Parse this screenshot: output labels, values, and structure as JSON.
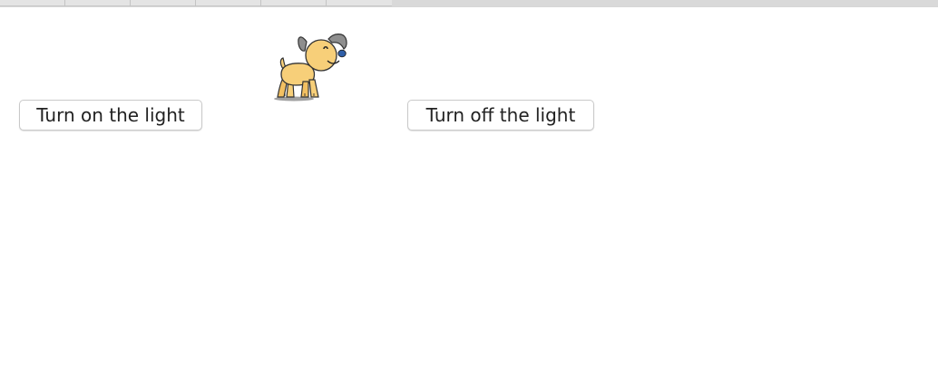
{
  "controls": {
    "turn_on_label": "Turn on the light",
    "turn_off_label": "Turn off the light"
  },
  "image": {
    "icon": "dog-icon"
  },
  "colors": {
    "dog_body": "#f7cf79",
    "dog_ear": "#8e8e8e",
    "dog_nose": "#2f5fa8",
    "outline": "#333333"
  }
}
